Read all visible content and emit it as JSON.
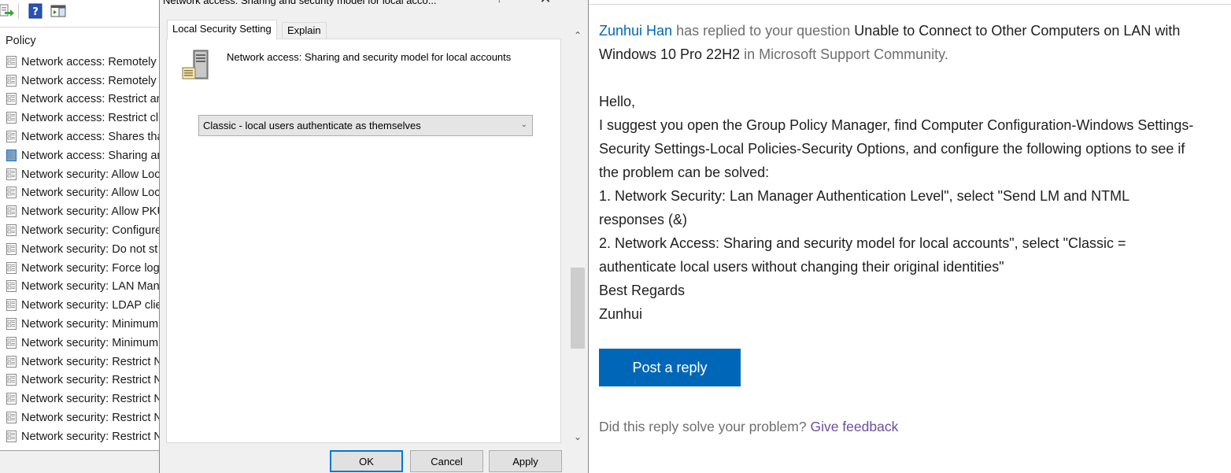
{
  "mmc": {
    "column_header": "Policy",
    "policies": [
      "Network access: Remotely a",
      "Network access: Remotely a",
      "Network access: Restrict anc",
      "Network access: Restrict clie",
      "Network access: Shares that",
      "Network access: Sharing an",
      "Network security: Allow Loc",
      "Network security: Allow Loc",
      "Network security: Allow PKU",
      "Network security: Configure",
      "Network security: Do not st",
      "Network security: Force log",
      "Network security: LAN Man",
      "Network security: LDAP clie",
      "Network security: Minimum",
      "Network security: Minimum",
      "Network security: Restrict N",
      "Network security: Restrict N",
      "Network security: Restrict N",
      "Network security: Restrict N",
      "Network security: Restrict N"
    ],
    "selected_index": 5
  },
  "dialog": {
    "title": "Network access: Sharing and security model for local acco...",
    "help_glyph": "?",
    "close_glyph": "✕",
    "tabs": [
      {
        "label": "Local Security Setting",
        "active": true
      },
      {
        "label": "Explain",
        "active": false
      }
    ],
    "policy_name": "Network access: Sharing and security model for local accounts",
    "selected_value": "Classic - local users authenticate as themselves",
    "buttons": {
      "ok": "OK",
      "cancel": "Cancel",
      "apply": "Apply"
    }
  },
  "web": {
    "notice": {
      "user": "Zunhui Han",
      "mid": " has replied to your question ",
      "question": "Unable to Connect to Other Computers on LAN with Windows 10 Pro 22H2",
      "tail": " in Microsoft Support Community."
    },
    "reply_lines": [
      "Hello,",
      "I suggest you open the Group Policy Manager, find Computer Configuration-Windows Settings-Security Settings-Local Policies-Security Options, and configure the following options to see if the problem can be solved:",
      "1. Network Security: Lan Manager Authentication Level\", select \"Send LM and NTML responses (&)",
      "2. Network Access: Sharing and security model for local accounts\", select \"Classic = authenticate local users without changing their original identities\"",
      "Best Regards",
      "Zunhui"
    ],
    "post_reply_label": "Post a reply",
    "feedback_question": "Did this reply solve your problem? ",
    "feedback_link": "Give feedback"
  },
  "colors": {
    "link_blue": "#0067b8",
    "button_blue": "#0067b8",
    "feedback_purple": "#6b4ea0"
  }
}
